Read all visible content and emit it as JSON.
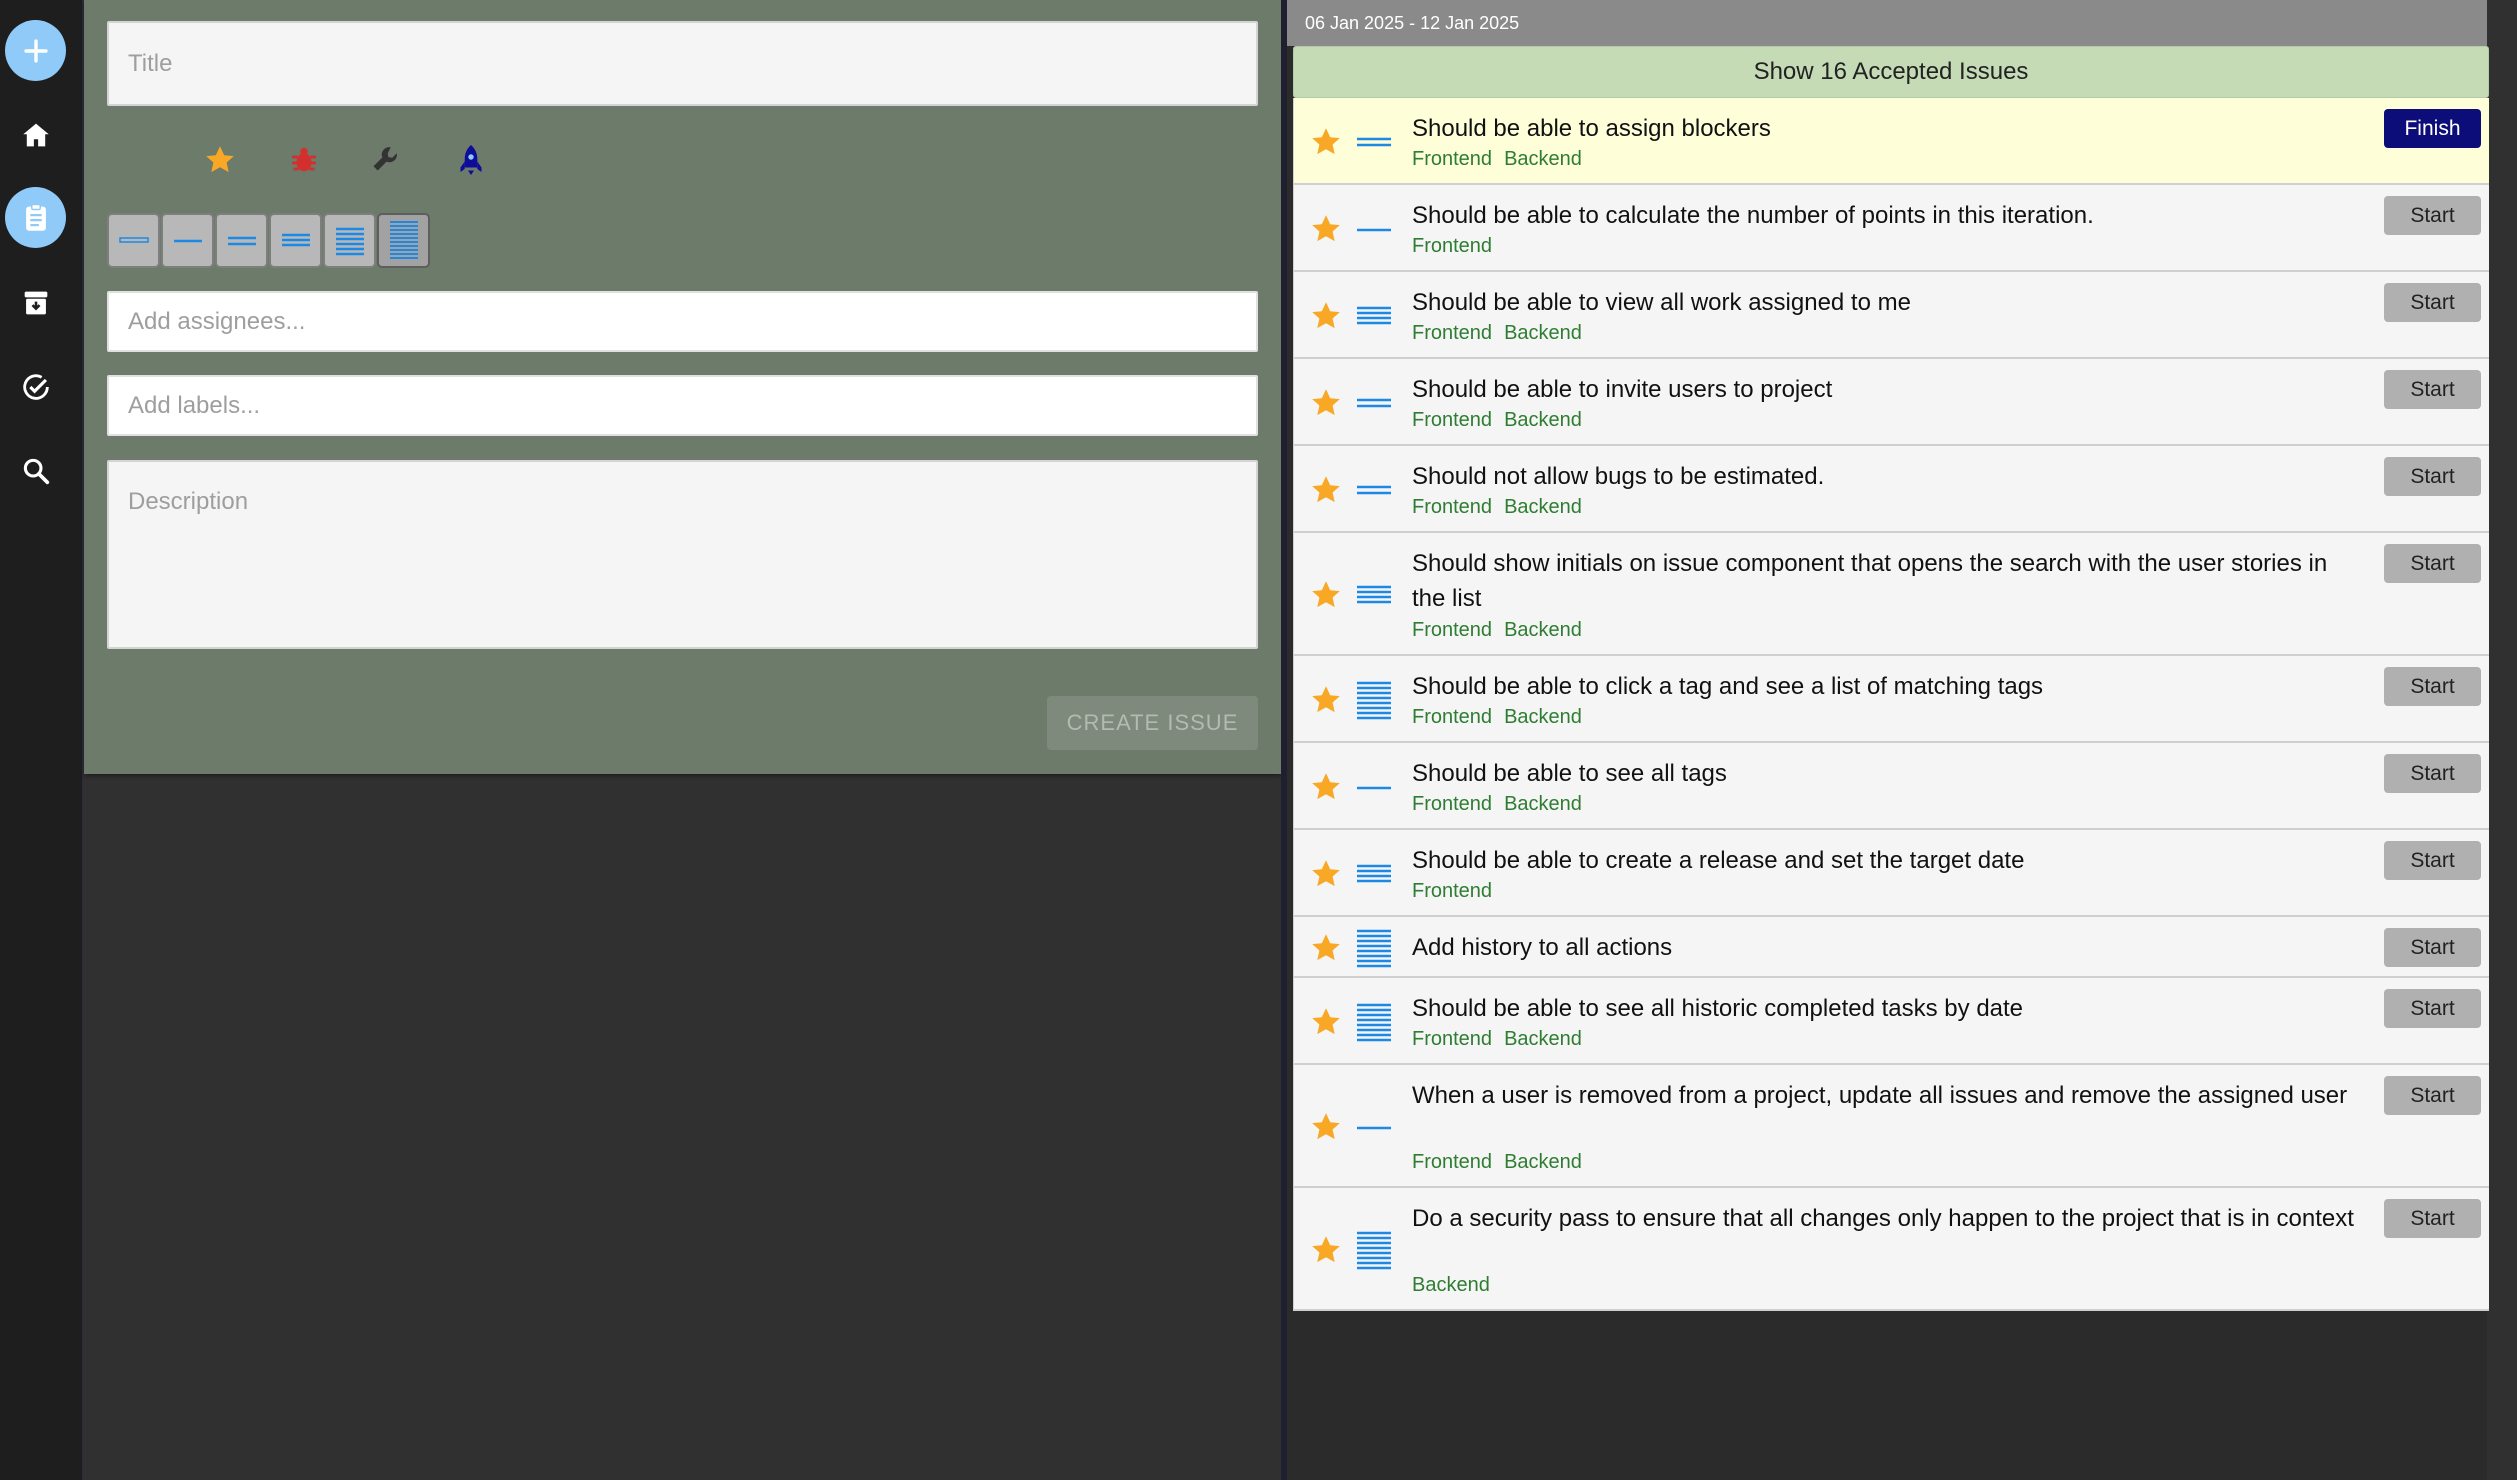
{
  "sidebar": {
    "items": [
      {
        "name": "add-icon",
        "label": "Add"
      },
      {
        "name": "home-icon",
        "label": "Home"
      },
      {
        "name": "clipboard-icon",
        "label": "Iteration"
      },
      {
        "name": "archive-icon",
        "label": "Backlog"
      },
      {
        "name": "check-circle-icon",
        "label": "Done"
      },
      {
        "name": "search-icon",
        "label": "Search"
      }
    ]
  },
  "form": {
    "title_placeholder": "Title",
    "issue_types": [
      "star-icon",
      "bug-icon",
      "wrench-icon",
      "rocket-icon"
    ],
    "estimates": [
      1,
      2,
      3,
      4,
      5,
      6
    ],
    "selected_estimate": 6,
    "assignees_placeholder": "Add assignees...",
    "labels_placeholder": "Add labels...",
    "description_placeholder": "Description",
    "create_label": "CREATE ISSUE"
  },
  "iteration": {
    "date_range": "06 Jan 2025 - 12 Jan 2025",
    "accepted_label": "Show 16 Accepted Issues",
    "issues": [
      {
        "title": "Should be able to assign blockers",
        "tags": [
          "Frontend",
          "Backend"
        ],
        "estimate": 2,
        "action": "Finish",
        "active": true
      },
      {
        "title": "Should be able to calculate the number of points in this iteration.",
        "tags": [
          "Frontend"
        ],
        "estimate": 1,
        "action": "Start"
      },
      {
        "title": "Should be able to view all work assigned to me",
        "tags": [
          "Frontend",
          "Backend"
        ],
        "estimate": 4,
        "action": "Start"
      },
      {
        "title": "Should be able to invite users to project",
        "tags": [
          "Frontend",
          "Backend"
        ],
        "estimate": 2,
        "action": "Start"
      },
      {
        "title": "Should not allow bugs to be estimated.",
        "tags": [
          "Frontend",
          "Backend"
        ],
        "estimate": 2,
        "action": "Start"
      },
      {
        "title": "Should show initials on issue component that opens the search with the user stories in the list",
        "tags": [
          "Frontend",
          "Backend"
        ],
        "estimate": 4,
        "action": "Start"
      },
      {
        "title": "Should be able to click a tag and see a list of matching tags",
        "tags": [
          "Frontend",
          "Backend"
        ],
        "estimate": 6,
        "action": "Start"
      },
      {
        "title": "Should be able to see all tags",
        "tags": [
          "Frontend",
          "Backend"
        ],
        "estimate": 1,
        "action": "Start"
      },
      {
        "title": "Should be able to create a release and set the target date",
        "tags": [
          "Frontend"
        ],
        "estimate": 4,
        "action": "Start"
      },
      {
        "title": "Add history to all actions",
        "tags": [],
        "estimate": 6,
        "action": "Start"
      },
      {
        "title": "Should be able to see all historic completed tasks by date",
        "tags": [
          "Frontend",
          "Backend"
        ],
        "estimate": 6,
        "action": "Start"
      },
      {
        "title": "When a user is removed from a project, update all issues and remove the assigned user",
        "tags": [
          "Frontend",
          "Backend"
        ],
        "estimate": 1,
        "action": "Start"
      },
      {
        "title": "Do a security pass to ensure that all changes only happen to the project that is in context",
        "tags": [
          "Backend"
        ],
        "estimate": 6,
        "action": "Start"
      }
    ]
  },
  "colors": {
    "accent": "#90caf9",
    "star": "#f9a825",
    "bug": "#d32f2f",
    "rocket": "#0d0d9a",
    "tag": "#2e7d32",
    "estimate_lines": "#1e88e5",
    "finish": "#0d0d7a"
  }
}
